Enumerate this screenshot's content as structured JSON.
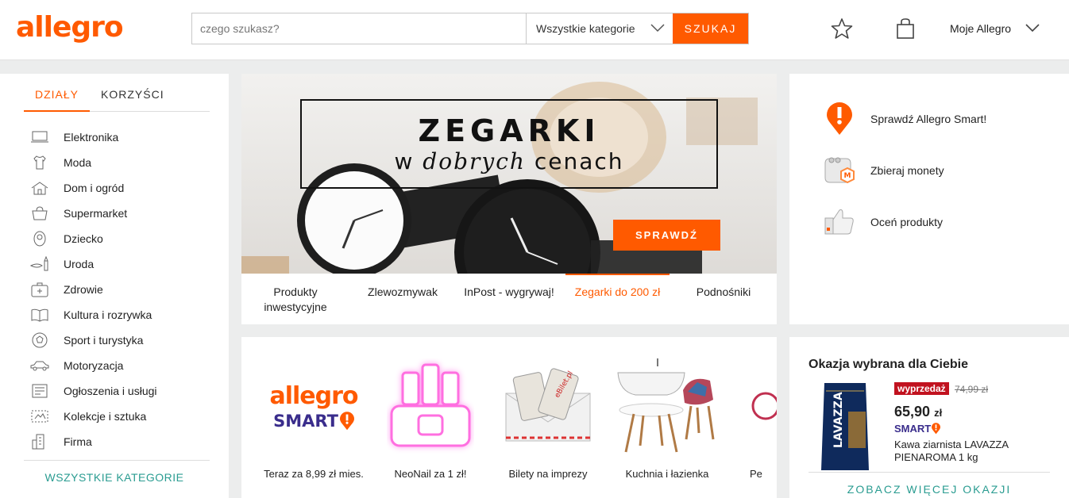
{
  "header": {
    "logo": "allegro",
    "search_placeholder": "czego szukasz?",
    "category_select": "Wszystkie kategorie",
    "search_button": "SZUKAJ",
    "account_label": "Moje Allegro",
    "accent_color": "#ff5a00"
  },
  "sidebar": {
    "tabs": [
      {
        "label": "DZIAŁY",
        "active": true
      },
      {
        "label": "KORZYŚCI",
        "active": false
      }
    ],
    "categories": [
      {
        "label": "Elektronika",
        "icon": "laptop-icon"
      },
      {
        "label": "Moda",
        "icon": "shirt-icon"
      },
      {
        "label": "Dom i ogród",
        "icon": "house-icon"
      },
      {
        "label": "Supermarket",
        "icon": "basket-icon"
      },
      {
        "label": "Dziecko",
        "icon": "baby-icon"
      },
      {
        "label": "Uroda",
        "icon": "lipstick-icon"
      },
      {
        "label": "Zdrowie",
        "icon": "first-aid-icon"
      },
      {
        "label": "Kultura i rozrywka",
        "icon": "book-icon"
      },
      {
        "label": "Sport i turystyka",
        "icon": "ball-icon"
      },
      {
        "label": "Motoryzacja",
        "icon": "car-icon"
      },
      {
        "label": "Ogłoszenia i usługi",
        "icon": "board-icon"
      },
      {
        "label": "Kolekcje i sztuka",
        "icon": "stamp-icon"
      },
      {
        "label": "Firma",
        "icon": "building-icon"
      }
    ],
    "all_categories": "WSZYSTKIE KATEGORIE"
  },
  "banner": {
    "title": "ZEGARKI",
    "subtitle_plain": "w",
    "subtitle_italic": "dobrych",
    "subtitle_end": "cenach",
    "button": "SPRAWDŹ",
    "tabs": [
      {
        "label": "Produkty inwestycyjne",
        "active": false
      },
      {
        "label": "Zlewozmywak",
        "active": false
      },
      {
        "label": "InPost - wygrywaj!",
        "active": false
      },
      {
        "label": "Zegarki do 200 zł",
        "active": true
      },
      {
        "label": "Podnośniki",
        "active": false
      }
    ]
  },
  "promo": {
    "items": [
      {
        "label": "Sprawdź Allegro Smart!",
        "icon": "alert-pin-icon"
      },
      {
        "label": "Zbieraj monety",
        "icon": "coin-purse-icon"
      },
      {
        "label": "Oceń produkty",
        "icon": "thumbs-up-icon"
      }
    ]
  },
  "tiles": [
    {
      "label": "Teraz za 8,99 zł mies.",
      "image": "allegro-smart-logo",
      "logo_top": "allegro",
      "logo_bottom": "SMART"
    },
    {
      "label": "NeoNail za 1 zł!",
      "image": "nail-polish-neon"
    },
    {
      "label": "Bilety na imprezy",
      "image": "tickets-envelope",
      "ticket_text": "eBilet.pl"
    },
    {
      "label": "Kuchnia i łazienka",
      "image": "bathtub-chairs"
    },
    {
      "label": "Pe",
      "image": "partial"
    }
  ],
  "deal": {
    "title": "Okazja wybrana dla Ciebie",
    "badge": "wyprzedaż",
    "old_price": "74,99 zł",
    "price_main": "65,90",
    "price_currency": "zł",
    "smart": "SMART",
    "description": "Kawa ziarnista LAVAZZA PIENAROMA 1 kg",
    "package_brand": "LAVAZZA",
    "more": "ZOBACZ WIĘCEJ OKAZJI"
  }
}
